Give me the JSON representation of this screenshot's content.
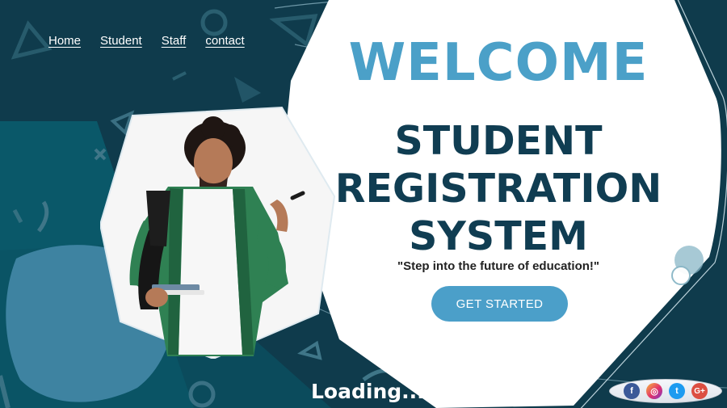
{
  "nav": {
    "items": [
      {
        "label": "Home"
      },
      {
        "label": "Student"
      },
      {
        "label": "Staff"
      },
      {
        "label": "contact"
      }
    ]
  },
  "hero": {
    "welcome": "WELCOME",
    "title_lines": [
      "STUDENT",
      "REGISTRATION",
      "SYSTEM"
    ],
    "tagline": "\"Step into the future of education!\"",
    "cta_label": "GET STARTED"
  },
  "status": {
    "loading_text": "Loading..."
  },
  "social": {
    "icons": [
      "facebook-icon",
      "instagram-icon",
      "twitter-icon",
      "google-plus-icon"
    ]
  },
  "colors": {
    "background_dark": "#0f3b4c",
    "background_teal": "#0d5a6b",
    "accent": "#4ba0c8",
    "title": "#103d52"
  }
}
